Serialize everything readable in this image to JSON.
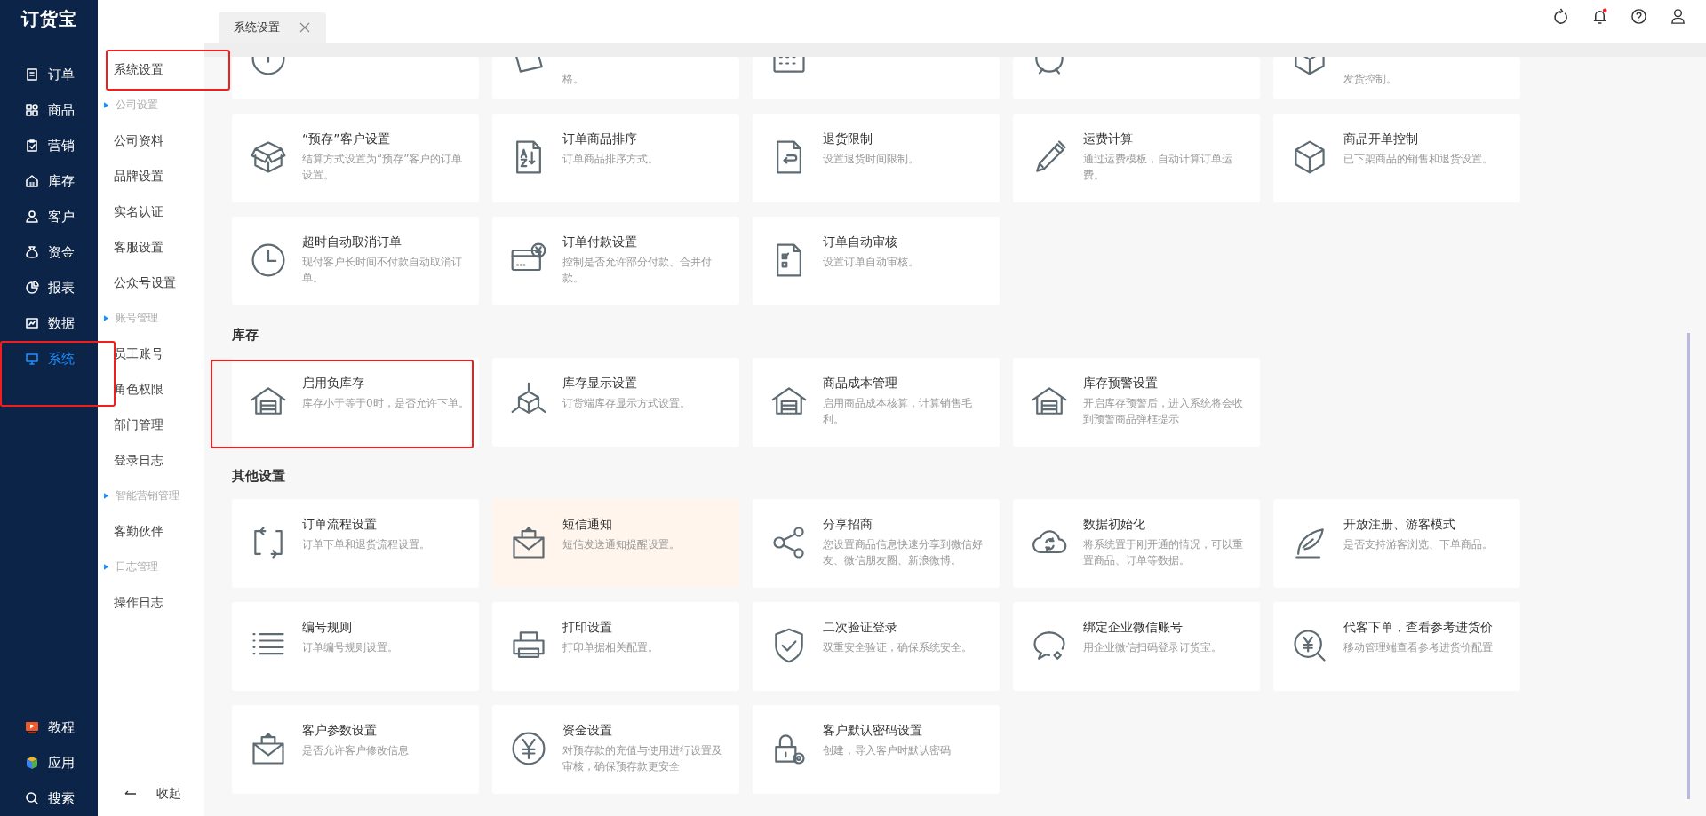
{
  "app": {
    "logo": "订货宝"
  },
  "main_nav": [
    {
      "label": "订单",
      "selected": false,
      "highlighted": false
    },
    {
      "label": "商品",
      "selected": false,
      "highlighted": false
    },
    {
      "label": "营销",
      "selected": false,
      "highlighted": false
    },
    {
      "label": "库存",
      "selected": false,
      "highlighted": false
    },
    {
      "label": "客户",
      "selected": false,
      "highlighted": false
    },
    {
      "label": "资金",
      "selected": false,
      "highlighted": false
    },
    {
      "label": "报表",
      "selected": false,
      "highlighted": false
    },
    {
      "label": "数据",
      "selected": false,
      "highlighted": false
    },
    {
      "label": "系统",
      "selected": true,
      "highlighted": true
    }
  ],
  "bottom_nav": [
    {
      "label": "教程"
    },
    {
      "label": "应用"
    },
    {
      "label": "搜索"
    }
  ],
  "sub_nav": {
    "items": [
      {
        "kind": "link",
        "label": "系统设置",
        "highlighted": true
      },
      {
        "kind": "group",
        "label": "公司设置"
      },
      {
        "kind": "link",
        "label": "公司资料",
        "highlighted": false
      },
      {
        "kind": "link",
        "label": "品牌设置",
        "highlighted": false
      },
      {
        "kind": "link",
        "label": "实名认证",
        "highlighted": false
      },
      {
        "kind": "link",
        "label": "客服设置",
        "highlighted": false
      },
      {
        "kind": "link",
        "label": "公众号设置",
        "highlighted": false
      },
      {
        "kind": "group",
        "label": "账号管理"
      },
      {
        "kind": "link",
        "label": "员工账号",
        "highlighted": false
      },
      {
        "kind": "link",
        "label": "角色权限",
        "highlighted": false
      },
      {
        "kind": "link",
        "label": "部门管理",
        "highlighted": false
      },
      {
        "kind": "link",
        "label": "登录日志",
        "highlighted": false
      },
      {
        "kind": "group",
        "label": "智能营销管理"
      },
      {
        "kind": "link",
        "label": "客勤伙伴",
        "highlighted": false
      },
      {
        "kind": "group",
        "label": "日志管理"
      },
      {
        "kind": "link",
        "label": "操作日志",
        "highlighted": false
      }
    ],
    "collapse": "收起"
  },
  "tabs": [
    {
      "label": "系统设置",
      "selected": true
    }
  ],
  "header": {
    "notification_unread": true
  },
  "sections": [
    {
      "cards": [
        {
          "partial": true
        },
        {
          "partial": true,
          "description": "格。"
        },
        {
          "partial": true
        },
        {
          "partial": true
        },
        {
          "partial": true,
          "description": "发货控制。"
        },
        {
          "title": "“预存”客户设置",
          "description": "结算方式设置为“预存”客户的订单设置。",
          "highlighted": false,
          "hovered": false
        },
        {
          "title": "订单商品排序",
          "description": "订单商品排序方式。",
          "highlighted": false,
          "hovered": false
        },
        {
          "title": "退货限制",
          "description": "设置退货时间限制。",
          "highlighted": false,
          "hovered": false
        },
        {
          "title": "运费计算",
          "description": "通过运费模板，自动计算订单运费。",
          "highlighted": false,
          "hovered": false
        },
        {
          "title": "商品开单控制",
          "description": "已下架商品的销售和退货设置。",
          "highlighted": false,
          "hovered": false
        },
        {
          "title": "超时自动取消订单",
          "description": "现付客户长时间不付款自动取消订单。",
          "highlighted": false,
          "hovered": false
        },
        {
          "title": "订单付款设置",
          "description": "控制是否允许部分付款、合并付款。",
          "highlighted": false,
          "hovered": false
        },
        {
          "title": "订单自动审核",
          "description": "设置订单自动审核。",
          "highlighted": false,
          "hovered": false
        }
      ]
    },
    {
      "title": "库存",
      "cards": [
        {
          "title": "启用负库存",
          "description": "库存小于等于0时，是否允许下单。",
          "highlighted": true,
          "hovered": false
        },
        {
          "title": "库存显示设置",
          "description": "订货端库存显示方式设置。",
          "highlighted": false,
          "hovered": false
        },
        {
          "title": "商品成本管理",
          "description": "启用商品成本核算，计算销售毛利。",
          "highlighted": false,
          "hovered": false
        },
        {
          "title": "库存预警设置",
          "description": "开启库存预警后，进入系统将会收到预警商品弹框提示",
          "highlighted": false,
          "hovered": false
        }
      ]
    },
    {
      "title": "其他设置",
      "cards": [
        {
          "title": "订单流程设置",
          "description": "订单下单和退货流程设置。",
          "highlighted": false,
          "hovered": false
        },
        {
          "title": "短信通知",
          "description": "短信发送通知提醒设置。",
          "highlighted": false,
          "hovered": true
        },
        {
          "title": "分享招商",
          "description": "您设置商品信息快速分享到微信好友、微信朋友圈、新浪微博。",
          "highlighted": false,
          "hovered": false
        },
        {
          "title": "数据初始化",
          "description": "将系统置于刚开通的情况，可以重置商品、订单等数据。",
          "highlighted": false,
          "hovered": false
        },
        {
          "title": "开放注册、游客模式",
          "description": "是否支持游客浏览、下单商品。",
          "highlighted": false,
          "hovered": false
        },
        {
          "title": "编号规则",
          "description": "订单编号规则设置。",
          "highlighted": false,
          "hovered": false
        },
        {
          "title": "打印设置",
          "description": "打印单据相关配置。",
          "highlighted": false,
          "hovered": false
        },
        {
          "title": "二次验证登录",
          "description": "双重安全验证，确保系统安全。",
          "highlighted": false,
          "hovered": false
        },
        {
          "title": "绑定企业微信账号",
          "description": "用企业微信扫码登录订货宝。",
          "highlighted": false,
          "hovered": false
        },
        {
          "title": "代客下单，查看参考进货价",
          "description": "移动管理端查看参考进货价配置",
          "highlighted": false,
          "hovered": false
        },
        {
          "title": "客户参数设置",
          "description": "是否允许客户修改信息",
          "highlighted": false,
          "hovered": false
        },
        {
          "title": "资金设置",
          "description": "对预存款的充值与使用进行设置及审核，确保预存款更安全",
          "highlighted": false,
          "hovered": false
        },
        {
          "title": "客户默认密码设置",
          "description": "创建，导入客户时默认密码",
          "highlighted": false,
          "hovered": false
        }
      ]
    }
  ]
}
